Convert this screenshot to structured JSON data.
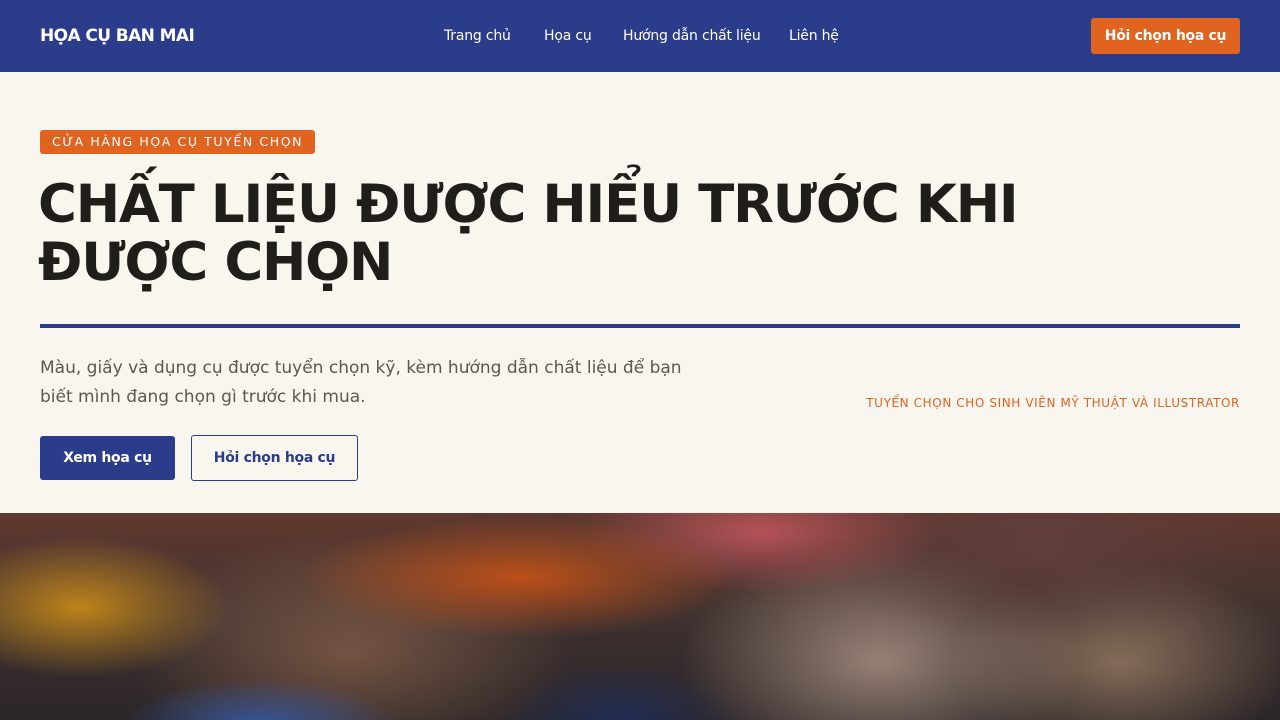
{
  "header": {
    "brand": "HỌA CỤ BAN MAI",
    "nav": [
      "Trang chủ",
      "Họa cụ",
      "Hướng dẫn chất liệu",
      "Liên hệ"
    ],
    "cta_label": "Hỏi chọn họa cụ"
  },
  "hero": {
    "eyebrow": "CỬA HÀNG HỌA CỤ TUYỂN CHỌN",
    "headline": "CHẤT LIỆU ĐƯỢC HIỂU TRƯỚC KHI ĐƯỢC CHỌN",
    "lede": "Màu, giấy và dụng cụ được tuyển chọn kỹ, kèm hướng dẫn chất liệu để bạn biết mình đang chọn gì trước khi mua.",
    "side_note": "TUYỂN CHỌN CHO SINH VIÊN MỸ THUẬT VÀ ILLUSTRATOR",
    "primary_label": "Xem họa cụ",
    "secondary_label": "Hỏi chọn họa cụ"
  },
  "colors": {
    "primary_navy": "#2b3c8b",
    "accent_orange": "#e06320",
    "background_cream": "#f9f6f0",
    "text_dark": "#1f1e1b"
  }
}
